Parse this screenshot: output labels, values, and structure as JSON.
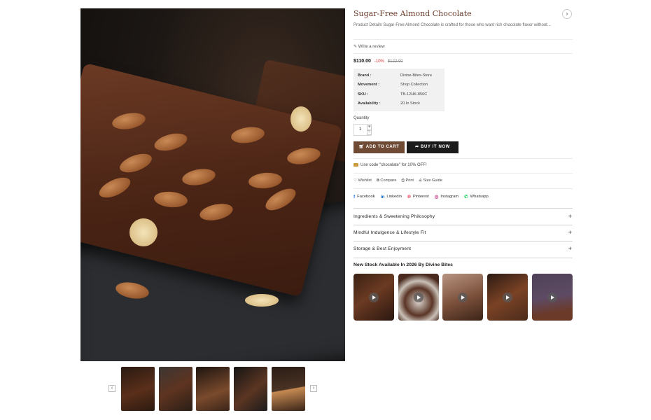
{
  "product": {
    "title": "Sugar-Free Almond Chocolate",
    "description": "Product Details Sugar-Free Almond Chocolate is crafted for those who want rich chocolate flavor without...",
    "share_icon": "chevron-right-icon",
    "review_link": "Write a review",
    "price_now": "$110.00",
    "price_discount": "-10%",
    "price_old": "$122.00"
  },
  "specs": [
    {
      "label": "Brand :",
      "value": "Divine-Bites-Store"
    },
    {
      "label": "Movement :",
      "value": "Shop Collection"
    },
    {
      "label": "SKU :",
      "value": "TB-12HK-856C"
    },
    {
      "label": "Availability :",
      "value": "20 In Stock"
    }
  ],
  "quantity": {
    "label": "Quantity",
    "value": "1",
    "plus": "+",
    "minus": "−"
  },
  "buttons": {
    "add_to_cart": "ADD TO CART",
    "buy_now": "BUY IT NOW"
  },
  "coupon": {
    "text": "Use code \"chocolate\" for 10% OFF!"
  },
  "actions": {
    "wishlist": "Wishlist",
    "compare": "Compare",
    "print": "Print",
    "size_guide": "Size Guide"
  },
  "social": {
    "facebook": "Facebook",
    "linkedin": "Linkedin",
    "pinterest": "Pinterest",
    "instagram": "Instagram",
    "whatsapp": "Whatsapp"
  },
  "accordions": [
    {
      "label": "Ingredients & Sweetening Philosophy",
      "icon": "+"
    },
    {
      "label": "Mindful Indulgence & Lifestyle Fit",
      "icon": "+"
    },
    {
      "label": "Storage & Best Enjoyment",
      "icon": "+"
    }
  ],
  "stock": {
    "title": "New Stock Available In 2026 By Divine Bites",
    "video_count": 5
  },
  "gallery": {
    "prev": "‹",
    "next": "›",
    "thumbnail_count": 5
  },
  "colors": {
    "brand_brown": "#6f4a34",
    "title_brown": "#6b3b2a",
    "discount_red": "#d12e2e",
    "buy_black": "#1b1b1b"
  }
}
